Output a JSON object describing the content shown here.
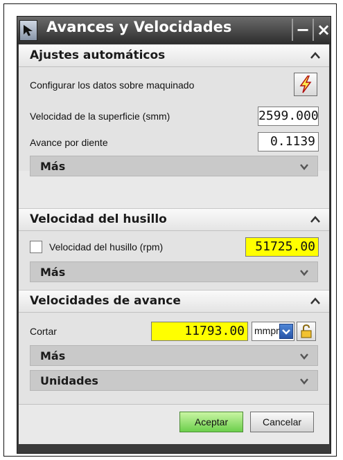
{
  "window": {
    "title": "Avances y Velocidades",
    "minimize_label": "−",
    "close_label": "×"
  },
  "sections": {
    "auto": {
      "title": "Ajustes automáticos",
      "config_label": "Configurar los datos sobre maquinado",
      "surface_speed_label": "Velocidad de la superficie (smm)",
      "surface_speed_value": "2599.000",
      "feed_per_tooth_label": "Avance por diente",
      "feed_per_tooth_value": "0.1139",
      "more_label": "Más"
    },
    "spindle": {
      "title": "Velocidad del husillo",
      "rpm_label": "Velocidad del husillo (rpm)",
      "rpm_value": "51725.00",
      "rpm_checked": false,
      "more_label": "Más"
    },
    "feed": {
      "title": "Velocidades de avance",
      "cut_label": "Cortar",
      "cut_value": "11793.00",
      "unit_value": "mmpm",
      "more_label": "Más",
      "units_label": "Unidades"
    }
  },
  "buttons": {
    "ok": "Aceptar",
    "cancel": "Cancelar"
  },
  "colors": {
    "highlight": "#ffff00",
    "ok_button": "#6ccf4c",
    "title_bar": "#2c2c2c"
  },
  "icons": {
    "title": "arrow-cursor-icon",
    "config": "lightning-icon",
    "lock": "padlock-icon"
  }
}
